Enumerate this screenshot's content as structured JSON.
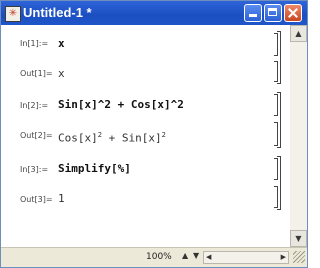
{
  "window": {
    "title": "Untitled-1 *"
  },
  "cells": [
    {
      "in_label": "In[1]:=",
      "input": "x",
      "out_label": "Out[1]=",
      "output": "x"
    },
    {
      "in_label": "In[2]:=",
      "input": "Sin[x]^2 + Cos[x]^2",
      "out_label": "Out[2]=",
      "output_parts": {
        "a": "Cos[x]",
        "a_exp": "2",
        "plus": " + ",
        "b": "Sin[x]",
        "b_exp": "2"
      }
    },
    {
      "in_label": "In[3]:=",
      "input": "Simplify[%]",
      "out_label": "Out[3]=",
      "output": "1"
    }
  ],
  "status": {
    "zoom": "100%"
  },
  "icons": {
    "app": "mathematica-notebook-icon",
    "minimize": "minimize-icon",
    "maximize": "maximize-icon",
    "close": "close-icon"
  }
}
